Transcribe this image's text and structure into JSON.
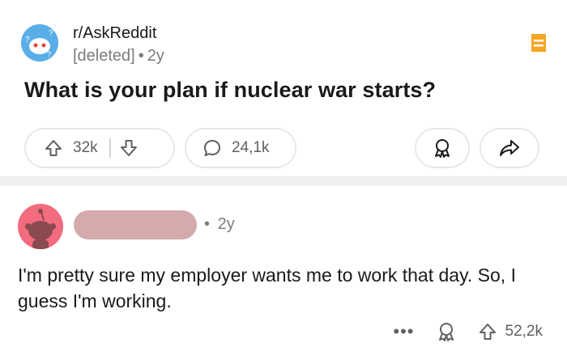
{
  "post": {
    "subreddit": "r/AskReddit",
    "author": "[deleted]",
    "separator": "•",
    "age": "2y",
    "title": "What is your plan if nuclear war starts?",
    "upvotes": "32k",
    "comments": "24,1k"
  },
  "comment": {
    "separator": "•",
    "age": "2y",
    "body": "I'm pretty sure my employer wants me to work that day. So, I guess I'm working.",
    "more": "•••",
    "upvotes": "52,2k"
  },
  "colors": {
    "save_icon": "#f5a623",
    "subreddit_avatar": "#5aaee8",
    "user_avatar": "#f26b7f",
    "username_redaction": "#d4aaac",
    "divider": "#f0f0f2"
  },
  "icons": [
    "subreddit-avatar-icon",
    "save-icon",
    "upvote-icon",
    "downvote-icon",
    "comment-icon",
    "award-icon",
    "share-icon",
    "snoo-avatar-icon",
    "more-icon"
  ]
}
